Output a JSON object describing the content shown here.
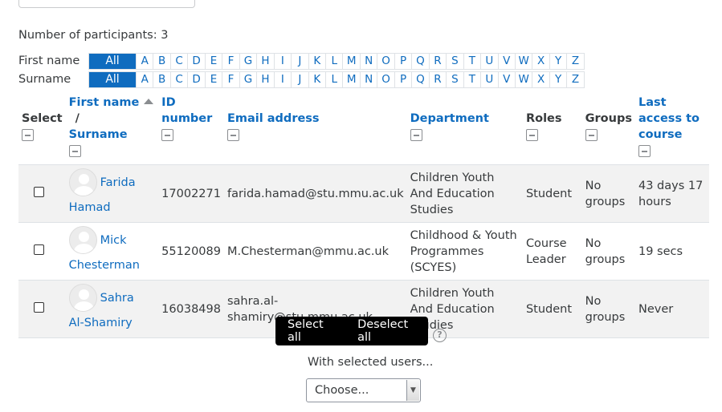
{
  "summary": {
    "participants_text": "Number of participants: 3"
  },
  "initials": {
    "firstname_label": "First name",
    "surname_label": "Surname",
    "all_label": "All",
    "letters": [
      "A",
      "B",
      "C",
      "D",
      "E",
      "F",
      "G",
      "H",
      "I",
      "J",
      "K",
      "L",
      "M",
      "N",
      "O",
      "P",
      "Q",
      "R",
      "S",
      "T",
      "U",
      "V",
      "W",
      "X",
      "Y",
      "Z"
    ]
  },
  "table": {
    "headers": {
      "select": "Select",
      "firstname": "First name",
      "separator": "/",
      "surname": "Surname",
      "idnumber": "ID number",
      "email": "Email address",
      "department": "Department",
      "roles": "Roles",
      "groups": "Groups",
      "lastaccess": "Last access to course"
    },
    "rows": [
      {
        "first": "Farida",
        "last": "Hamad",
        "id": "17002271",
        "email": "farida.hamad@stu.mmu.ac.uk",
        "department": "Children Youth And Education Studies",
        "role": "Student",
        "groups": "No groups",
        "lastaccess": "43 days 17 hours"
      },
      {
        "first": "Mick",
        "last": "Chesterman",
        "id": "55120089",
        "email": "M.Chesterman@mmu.ac.uk",
        "department": "Childhood & Youth Programmes (SCYES)",
        "role": "Course Leader",
        "groups": "No groups",
        "lastaccess": "19 secs"
      },
      {
        "first": "Sahra",
        "last": "Al-Shamiry",
        "id": "16038498",
        "email": "sahra.al-shamiry@stu.mmu.ac.uk",
        "department": "Children Youth And Education Studies",
        "role": "Student",
        "groups": "No groups",
        "lastaccess": "Never"
      }
    ]
  },
  "actions": {
    "select_all": "Select all",
    "deselect_all": "Deselect all",
    "help": "?",
    "with_selected": "With selected users...",
    "choose": "Choose..."
  },
  "colors": {
    "link": "#0f6cbf",
    "all_bg": "#0f6cbf",
    "button_bg": "#000000",
    "row_stripe": "#f2f2f2"
  }
}
